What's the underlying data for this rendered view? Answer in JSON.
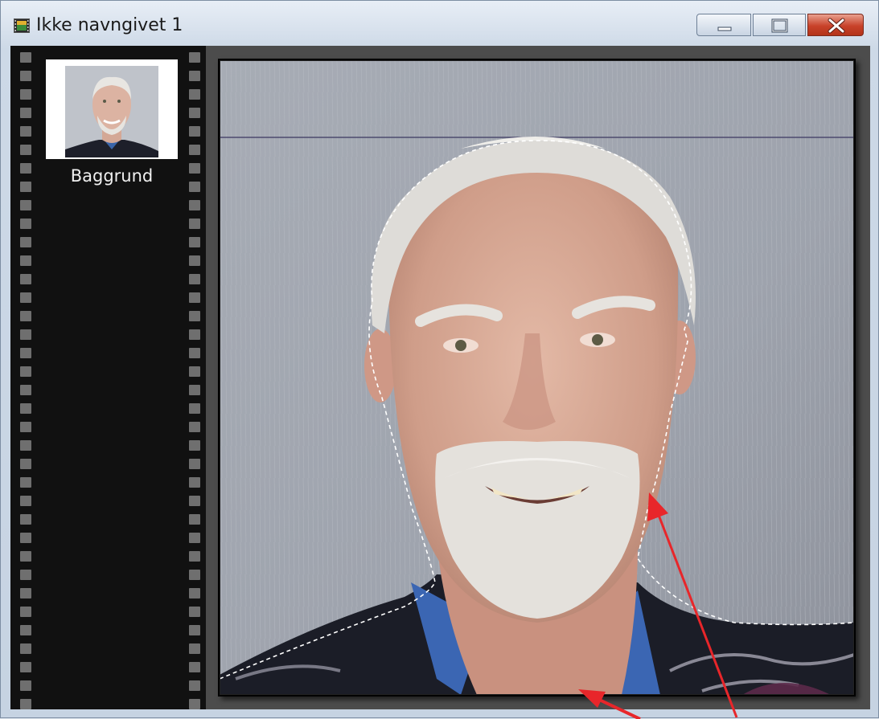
{
  "window": {
    "title": "Ikke navngivet 1"
  },
  "titlebar_buttons": [
    "minimize",
    "maximize",
    "close"
  ],
  "icons": {
    "app": "film-app-icon",
    "minimize": "minimize-icon",
    "maximize": "maximize-icon",
    "close": "close-icon"
  },
  "layers": [
    {
      "label": "Baggrund"
    }
  ],
  "colors": {
    "close_button": "#c8422a",
    "annotation_arrow": "#e8262a",
    "selection_marquee": "#ffffff"
  }
}
